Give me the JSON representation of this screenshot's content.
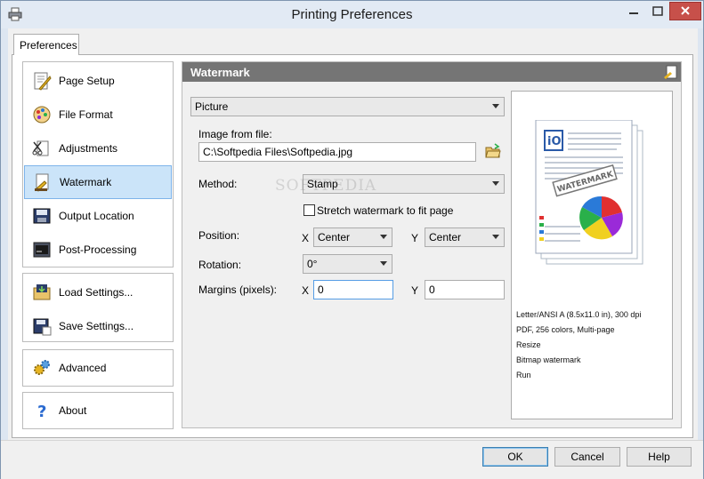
{
  "window": {
    "title": "Printing Preferences"
  },
  "tabs": [
    {
      "label": "Preferences",
      "active": true
    }
  ],
  "nav": {
    "group1": [
      {
        "label": "Page Setup",
        "icon": "page-setup-icon"
      },
      {
        "label": "File Format",
        "icon": "file-format-icon"
      },
      {
        "label": "Adjustments",
        "icon": "adjustments-icon"
      },
      {
        "label": "Watermark",
        "icon": "watermark-icon",
        "active": true
      },
      {
        "label": "Output Location",
        "icon": "output-location-icon"
      },
      {
        "label": "Post-Processing",
        "icon": "post-processing-icon"
      }
    ],
    "group2": [
      {
        "label": "Load Settings...",
        "icon": "load-settings-icon"
      },
      {
        "label": "Save Settings...",
        "icon": "save-settings-icon"
      }
    ],
    "group3": [
      {
        "label": "Advanced",
        "icon": "gears-icon"
      }
    ],
    "group4": [
      {
        "label": "About",
        "icon": "question-icon"
      }
    ]
  },
  "panel": {
    "header": "Watermark",
    "type_select": "Picture",
    "image_label": "Image from file:",
    "image_path": "C:\\Softpedia Files\\Softpedia.jpg",
    "method_label": "Method:",
    "method_value": "Stamp",
    "stretch_label": "Stretch watermark to fit page",
    "stretch_checked": false,
    "position_label": "Position:",
    "position_x_label": "X",
    "position_x_value": "Center",
    "position_y_label": "Y",
    "position_y_value": "Center",
    "rotation_label": "Rotation:",
    "rotation_value": "0°",
    "margins_label": "Margins (pixels):",
    "margins_x_label": "X",
    "margins_x_value": "0",
    "margins_y_label": "Y",
    "margins_y_value": "0"
  },
  "preview": {
    "watermark_text": "WATERMARK",
    "logo_text": "iO",
    "info": [
      "Letter/ANSI A (8.5x11.0 in), 300 dpi",
      "PDF, 256 colors, Multi-page",
      "Resize",
      "Bitmap watermark",
      "Run"
    ]
  },
  "background_watermark": "SOFTPEDIA",
  "buttons": {
    "ok": "OK",
    "cancel": "Cancel",
    "help": "Help"
  },
  "colors": {
    "accent": "#3c7fb1",
    "header_bg": "#757575",
    "active_nav": "#cbe4f9",
    "close": "#c7504a"
  }
}
